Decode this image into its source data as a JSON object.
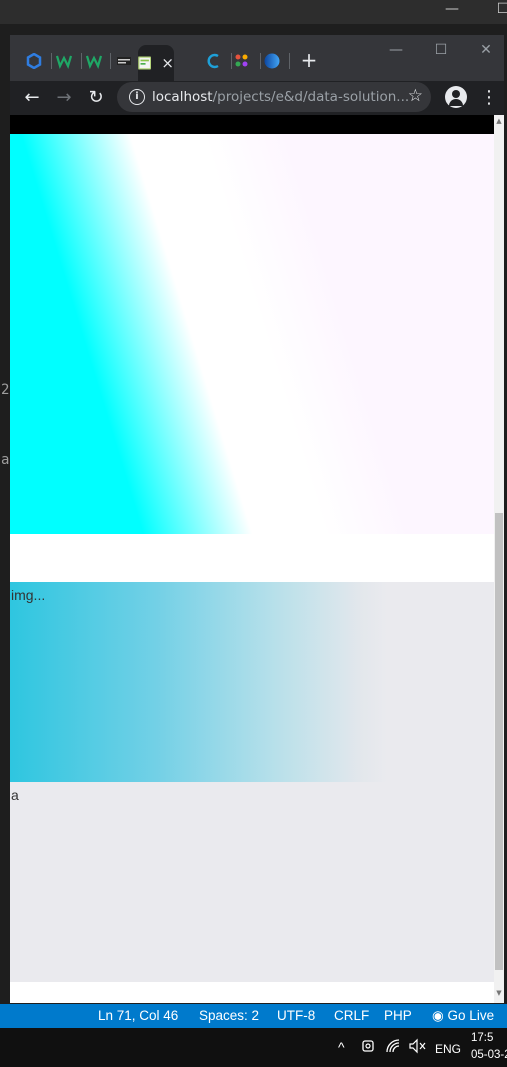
{
  "background_editor": {
    "fragments": [
      "2",
      "a"
    ]
  },
  "browser": {
    "tabs": [
      {
        "icon": "blue-hexagon-icon",
        "color": "#2f7de1"
      },
      {
        "icon": "w-logo-icon",
        "color": "#1fa866"
      },
      {
        "icon": "w-logo-icon",
        "color": "#1fa866"
      },
      {
        "icon": "dark-logo-icon",
        "color": "#555555"
      },
      {
        "icon": "document-icon",
        "color": "#b5d67a",
        "active": true
      },
      {
        "icon": "c-logo-icon",
        "color": "#1ea0d8"
      },
      {
        "icon": "colorful-dots-icon",
        "color": "#e5533d"
      },
      {
        "icon": "globe-icon",
        "color": "#1565c0"
      }
    ],
    "active_tab_close": "×",
    "new_tab": "+",
    "window_controls": {
      "minimize": "—",
      "maximize": "☐",
      "close": "✕"
    },
    "toolbar": {
      "back": "←",
      "forward": "→",
      "reload": "↻",
      "url_host": "localhost",
      "url_path": "/projects/e&d/data-solution...",
      "star": "☆",
      "menu": "⋮"
    }
  },
  "page": {
    "img_alt": "img...",
    "caption": "a",
    "colors": {
      "hero_left": "#00ffff",
      "hero_right": "#fdf6ff",
      "section_bg": "#eaeaee",
      "image_gradient": "#2ec6e0"
    }
  },
  "status_bar": {
    "position": "Ln 71, Col 46",
    "spaces": "Spaces: 2",
    "encoding": "UTF-8",
    "eol": "CRLF",
    "language": "PHP",
    "go_live": "Go Live",
    "color": "#007acc"
  },
  "taskbar": {
    "chevron": "^",
    "language": "ENG",
    "time": "17:5",
    "date": "05-03-2"
  }
}
